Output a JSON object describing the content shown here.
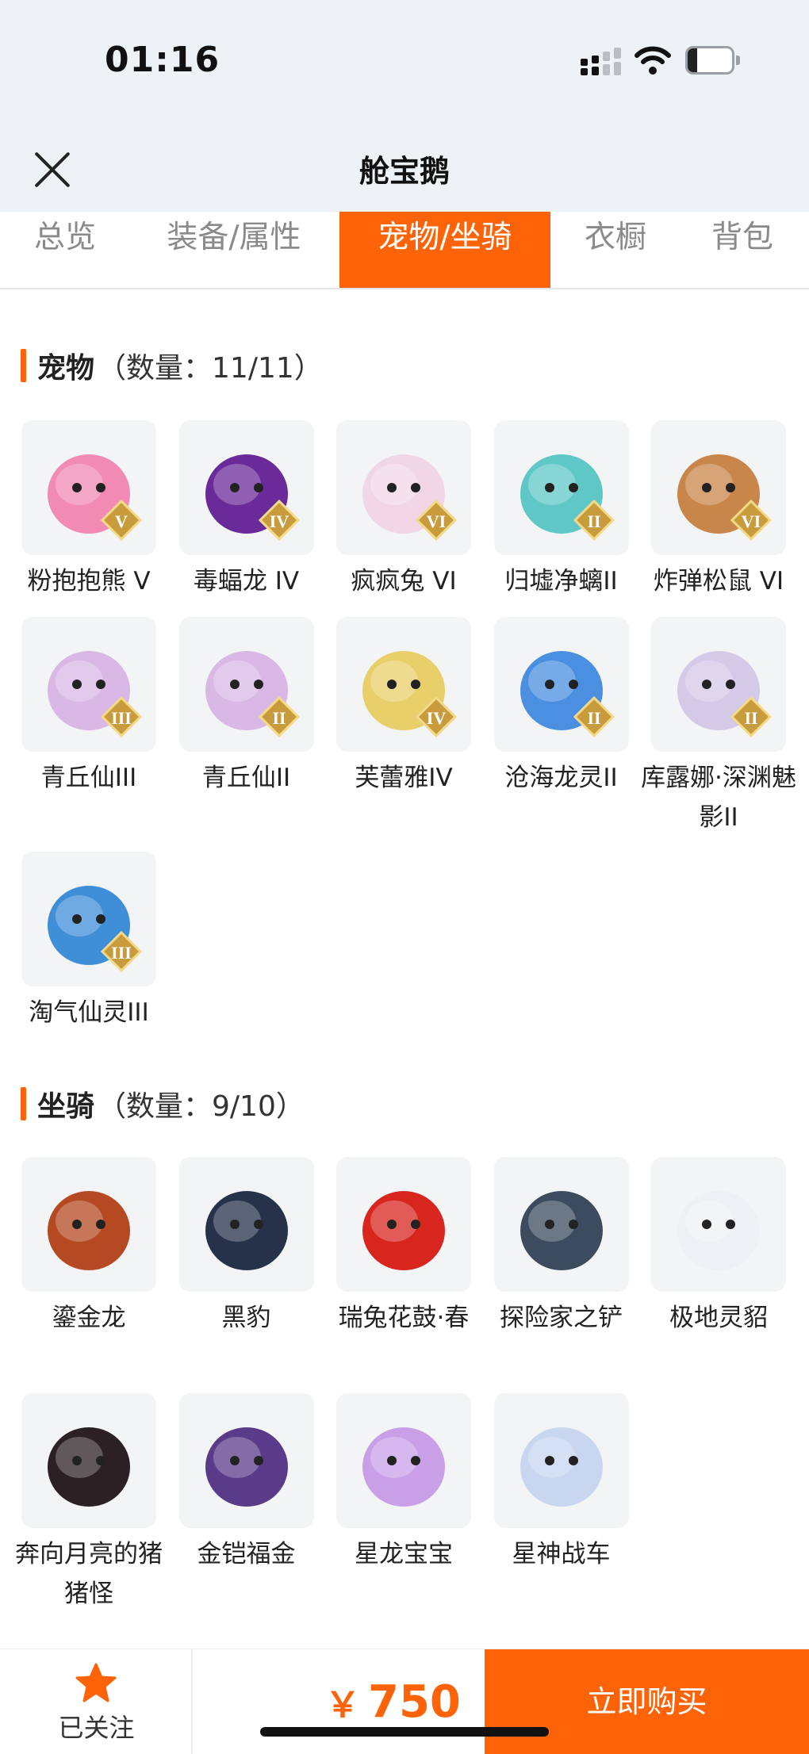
{
  "status_bar": {
    "time": "01:16",
    "battery": "21",
    "battery_level": 0.21
  },
  "header": {
    "title": "舱宝鹅"
  },
  "tabs": [
    {
      "label": "总览",
      "active": false
    },
    {
      "label": "装备/属性",
      "active": false
    },
    {
      "label": "宠物/坐骑",
      "active": true
    },
    {
      "label": "衣橱",
      "active": false
    },
    {
      "label": "背包",
      "active": false
    }
  ],
  "pets": {
    "title": "宠物",
    "count": "（数量：11/11）",
    "items": [
      {
        "name": "粉抱抱熊 V",
        "rank": "V",
        "icon": "pink-bear-icon",
        "color": "#f28bb3"
      },
      {
        "name": "毒蝠龙 IV",
        "rank": "IV",
        "icon": "purple-dragon-icon",
        "color": "#6b2a9a"
      },
      {
        "name": "疯疯兔 VI",
        "rank": "VI",
        "icon": "rabbit-icon",
        "color": "#f1d7e6"
      },
      {
        "name": "归墟净螭II",
        "rank": "II",
        "icon": "sea-dragon-icon",
        "color": "#5fc7c6"
      },
      {
        "name": "炸弹松鼠 VI",
        "rank": "VI",
        "icon": "squirrel-icon",
        "color": "#c9864a"
      },
      {
        "name": "青丘仙III",
        "rank": "III",
        "icon": "fox-fairy-icon",
        "color": "#d9b8e6"
      },
      {
        "name": "青丘仙II",
        "rank": "II",
        "icon": "fox-fairy-icon",
        "color": "#d9b8e6"
      },
      {
        "name": "芙蕾雅IV",
        "rank": "IV",
        "icon": "freya-icon",
        "color": "#e8cf6a"
      },
      {
        "name": "沧海龙灵II",
        "rank": "II",
        "icon": "dragon-spirit-icon",
        "color": "#4a8fe0"
      },
      {
        "name": "库露娜·深渊魅影II",
        "rank": "II",
        "icon": "kuluna-icon",
        "color": "#d5c9e8"
      },
      {
        "name": "淘气仙灵III",
        "rank": "III",
        "icon": "blue-pup-icon",
        "color": "#3f8fd8"
      }
    ]
  },
  "mounts": {
    "title": "坐骑",
    "count": "（数量：9/10）",
    "items": [
      {
        "name": "鎏金龙",
        "icon": "golden-dragon-icon",
        "color": "#b54a22"
      },
      {
        "name": "黑豹",
        "icon": "panther-icon",
        "color": "#26324a"
      },
      {
        "name": "瑞兔花鼓·春",
        "icon": "drum-icon",
        "color": "#d8261f"
      },
      {
        "name": "探险家之铲",
        "icon": "shovel-icon",
        "color": "#3d4b5e"
      },
      {
        "name": "极地灵貂",
        "icon": "polar-mink-icon",
        "color": "#eef0f3"
      },
      {
        "name": "奔向月亮的猪猪怪",
        "icon": "pig-icon",
        "color": "#2b2024"
      },
      {
        "name": "金铠福金",
        "icon": "armored-beast-icon",
        "color": "#5a3b8a"
      },
      {
        "name": "星龙宝宝",
        "icon": "star-dragon-icon",
        "color": "#c9a0e8"
      },
      {
        "name": "星神战车",
        "icon": "star-steed-icon",
        "color": "#c8d6f0"
      }
    ]
  },
  "bottom_bar": {
    "follow_label": "已关注",
    "follow_icon": "star-icon",
    "currency": "￥",
    "price": "750",
    "buy_label": "立即购买"
  },
  "colors": {
    "accent": "#ff6308",
    "header_bg": "#ecf2f6"
  }
}
